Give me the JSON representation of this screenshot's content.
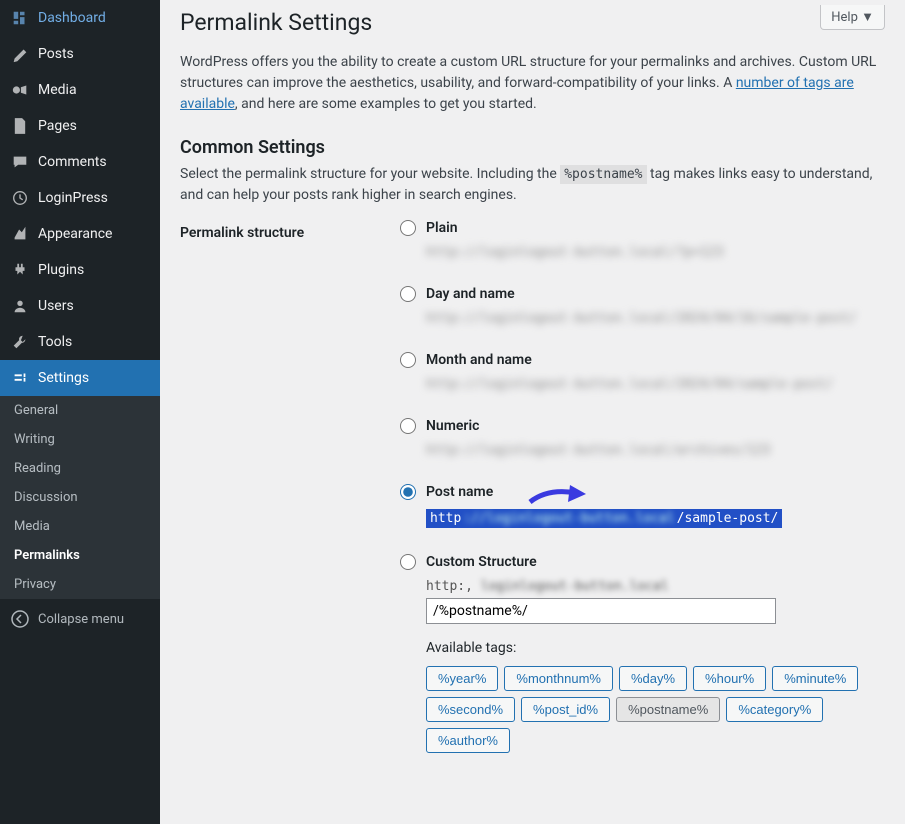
{
  "help_button": "Help ▼",
  "sidebar": {
    "items": [
      {
        "label": "Dashboard",
        "icon": "dashboard-icon"
      },
      {
        "label": "Posts",
        "icon": "posts-icon"
      },
      {
        "label": "Media",
        "icon": "media-icon"
      },
      {
        "label": "Pages",
        "icon": "pages-icon"
      },
      {
        "label": "Comments",
        "icon": "comments-icon"
      },
      {
        "label": "LoginPress",
        "icon": "loginpress-icon"
      },
      {
        "label": "Appearance",
        "icon": "appearance-icon"
      },
      {
        "label": "Plugins",
        "icon": "plugins-icon"
      },
      {
        "label": "Users",
        "icon": "users-icon"
      },
      {
        "label": "Tools",
        "icon": "tools-icon"
      },
      {
        "label": "Settings",
        "icon": "settings-icon",
        "active": true
      }
    ],
    "submenu": [
      "General",
      "Writing",
      "Reading",
      "Discussion",
      "Media",
      "Permalinks",
      "Privacy"
    ],
    "submenu_current": "Permalinks",
    "collapse": "Collapse menu"
  },
  "page": {
    "title": "Permalink Settings",
    "intro_prefix": "WordPress offers you the ability to create a custom URL structure for your permalinks and archives. Custom URL structures can improve the aesthetics, usability, and forward-compatibility of your links. A ",
    "intro_link": "number of tags are available",
    "intro_suffix": ", and here are some examples to get you started.",
    "common_settings_heading": "Common Settings",
    "common_desc_prefix": "Select the permalink structure for your website. Including the ",
    "common_desc_tag": "%postname%",
    "common_desc_suffix": " tag makes links easy to understand, and can help your posts rank higher in search engines.",
    "permalink_label": "Permalink structure",
    "options": {
      "plain": "Plain",
      "day_name": "Day and name",
      "month_name": "Month and name",
      "numeric": "Numeric",
      "post_name": "Post name",
      "custom": "Custom Structure"
    },
    "selected_url_prefix": "http",
    "selected_url_suffix": "/sample-post/",
    "custom_prefix_visible": "http:,",
    "custom_input_value": "/%postname%/",
    "available_tags_label": "Available tags:",
    "tags": [
      "%year%",
      "%monthnum%",
      "%day%",
      "%hour%",
      "%minute%",
      "%second%",
      "%post_id%",
      "%postname%",
      "%category%",
      "%author%"
    ],
    "active_tag": "%postname%"
  }
}
